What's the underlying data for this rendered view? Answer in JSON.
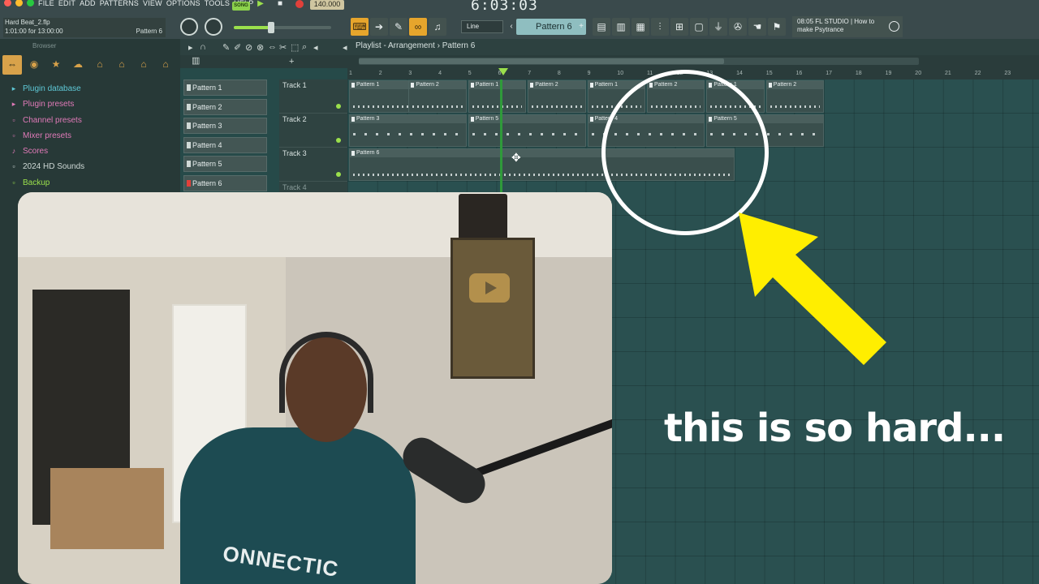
{
  "menu": [
    "FILE",
    "EDIT",
    "ADD",
    "PATTERNS",
    "VIEW",
    "OPTIONS",
    "TOOLS",
    "HELP"
  ],
  "window_dots": [
    "#ff5f57",
    "#febc2e",
    "#28c840"
  ],
  "transport": {
    "mode": "SONG",
    "tempo": "140.000",
    "time": "6:03:03"
  },
  "file": {
    "name": "Hard Beat_2.flp",
    "time": "1:01:00 for 13:00:00",
    "pattern": "Pattern 6"
  },
  "snap": "Line",
  "pattern_selector": "Pattern 6",
  "news": "08:05 FL STUDIO | How to make Psytrance",
  "browser": {
    "title": "Browser",
    "items": [
      {
        "label": "Plugin database",
        "color": "#5ec8d6",
        "icon": "plugin-database-icon"
      },
      {
        "label": "Plugin presets",
        "color": "#e07ab8",
        "icon": "plugin-presets-icon"
      },
      {
        "label": "Channel presets",
        "color": "#e07ab8",
        "icon": "channel-presets-icon"
      },
      {
        "label": "Mixer presets",
        "color": "#e07ab8",
        "icon": "mixer-presets-icon"
      },
      {
        "label": "Scores",
        "color": "#e07ab8",
        "icon": "scores-icon"
      },
      {
        "label": "2024 HD Sounds",
        "color": "#cfd9d6",
        "icon": "folder-icon"
      },
      {
        "label": "Backup",
        "color": "#9be04c",
        "icon": "backup-folder-icon"
      }
    ]
  },
  "playlist": {
    "breadcrumb": "Playlist - Arrangement",
    "separator": "›",
    "current_pattern": "Pattern 6",
    "patterns": [
      "Pattern 1",
      "Pattern 2",
      "Pattern 3",
      "Pattern 4",
      "Pattern 5",
      "Pattern 6"
    ],
    "tracks": [
      "Track 1",
      "Track 2",
      "Track 3",
      "Track 4"
    ],
    "bars": [
      "1",
      "2",
      "3",
      "4",
      "5",
      "6",
      "7",
      "8",
      "9",
      "10",
      "11",
      "12",
      "13",
      "14",
      "15",
      "16",
      "17",
      "18",
      "19",
      "20",
      "21",
      "22",
      "23"
    ],
    "clips": [
      {
        "track": 1,
        "label": "Pattern 1",
        "start": 1,
        "len": 4
      },
      {
        "track": 1,
        "label": "Pattern 2",
        "start": 3,
        "len": 2
      },
      {
        "track": 1,
        "label": "Pattern 1",
        "start": 5,
        "len": 2
      },
      {
        "track": 1,
        "label": "Pattern 2",
        "start": 7,
        "len": 2
      },
      {
        "track": 1,
        "label": "Pattern 1",
        "start": 9,
        "len": 2
      },
      {
        "track": 1,
        "label": "Pattern 2",
        "start": 11,
        "len": 2
      },
      {
        "track": 1,
        "label": "Pattern 1",
        "start": 13,
        "len": 2
      },
      {
        "track": 1,
        "label": "Pattern 2",
        "start": 15,
        "len": 2
      },
      {
        "track": 2,
        "label": "Pattern 3",
        "start": 1,
        "len": 4
      },
      {
        "track": 2,
        "label": "Pattern 5",
        "start": 5,
        "len": 4
      },
      {
        "track": 2,
        "label": "Pattern 4",
        "start": 9,
        "len": 4
      },
      {
        "track": 2,
        "label": "Pattern 5",
        "start": 13,
        "len": 4
      },
      {
        "track": 3,
        "label": "Pattern 6",
        "start": 1,
        "len": 13
      }
    ]
  },
  "caption": "this is so hard...",
  "overlay_colors": {
    "circle": "#ffffff",
    "arrow": "#ffee00"
  },
  "webcam": {
    "jersey_text": "ONNECTIC"
  }
}
